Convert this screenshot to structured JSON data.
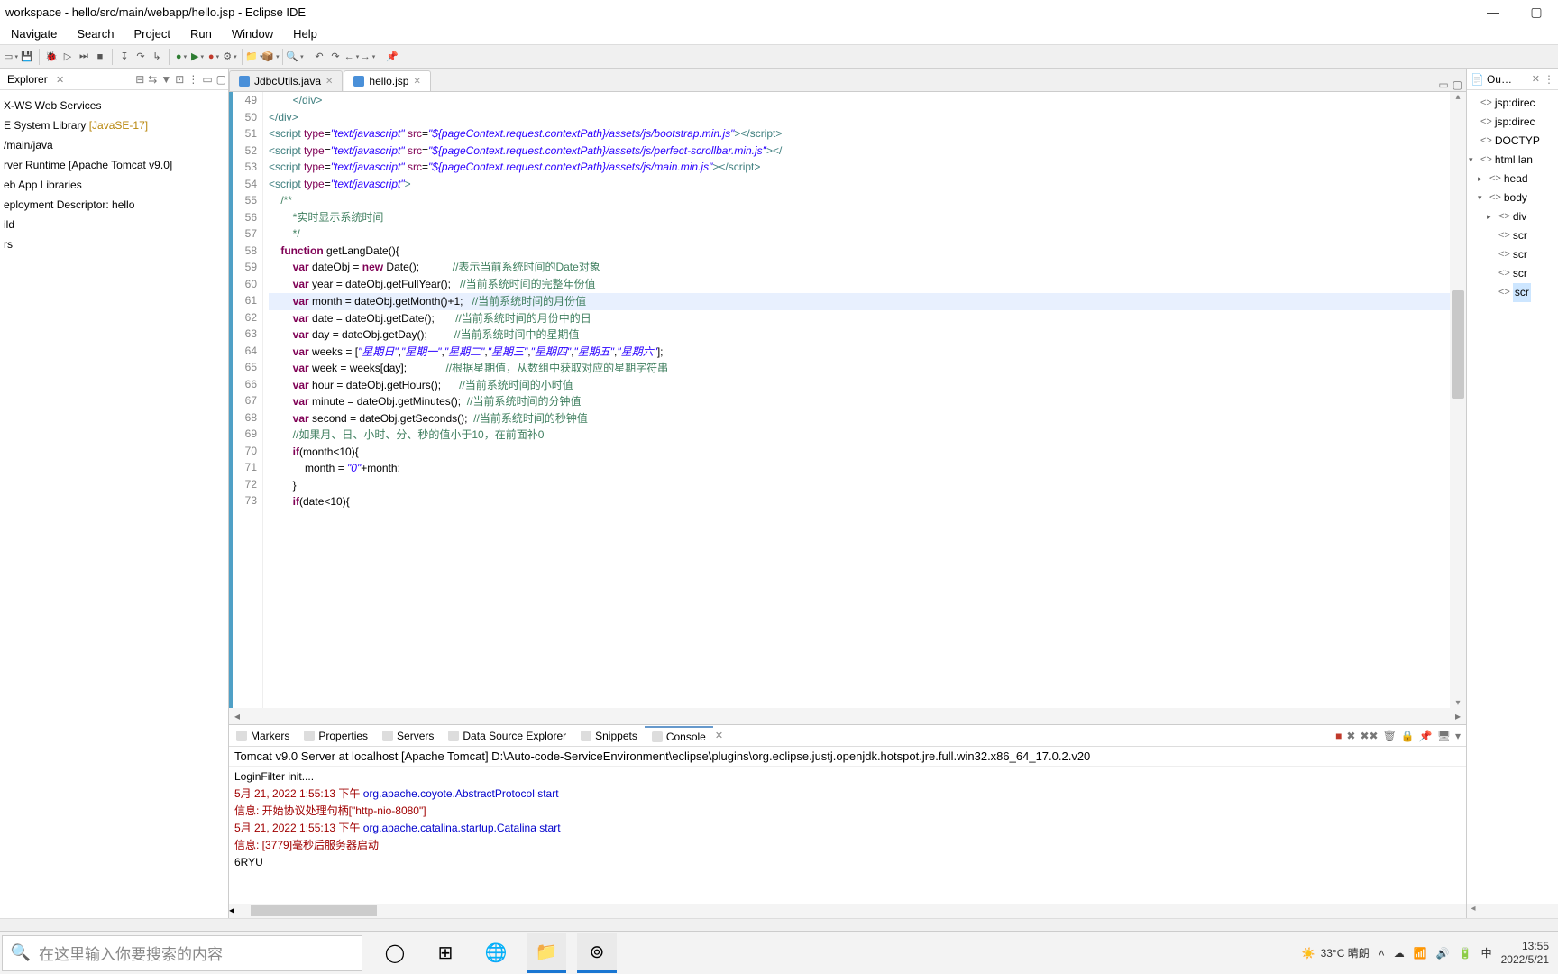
{
  "window": {
    "title": "workspace - hello/src/main/webapp/hello.jsp - Eclipse IDE"
  },
  "menu": [
    "Navigate",
    "Search",
    "Project",
    "Run",
    "Window",
    "Help"
  ],
  "explorer": {
    "title": "Explorer",
    "items": [
      {
        "label": "X-WS Web Services"
      },
      {
        "label": "E System Library ",
        "hint": "[JavaSE-17]"
      },
      {
        "label": "/main/java"
      },
      {
        "label": "rver Runtime [Apache Tomcat v9.0]"
      },
      {
        "label": "eb App Libraries"
      },
      {
        "label": "eployment Descriptor: hello"
      },
      {
        "label": "ild"
      },
      {
        "label": "rs"
      }
    ]
  },
  "editor": {
    "tabs": [
      {
        "label": "JdbcUtils.java",
        "active": false
      },
      {
        "label": "hello.jsp",
        "active": true
      }
    ],
    "firstLine": 49,
    "highlight": 61,
    "lines": [
      {
        "n": 49,
        "html": "        <span class='tag'>&lt;/div&gt;</span>"
      },
      {
        "n": 50,
        "html": "<span class='tag'>&lt;/div&gt;</span>"
      },
      {
        "n": 51,
        "html": "<span class='tag'>&lt;script</span> <span class='attr'>type</span>=<span class='str'>\"text/javascript\"</span> <span class='attr'>src</span>=<span class='str'>\"${pageContext.request.contextPath}</span><span class='str'>/assets/js/bootstrap.min.js\"</span><span class='tag'>&gt;&lt;/script&gt;</span>"
      },
      {
        "n": 52,
        "html": "<span class='tag'>&lt;script</span> <span class='attr'>type</span>=<span class='str'>\"text/javascript\"</span> <span class='attr'>src</span>=<span class='str'>\"${pageContext.request.contextPath}</span><span class='str'>/assets/js/perfect-scrollbar.min.js\"</span><span class='tag'>&gt;&lt;/</span>"
      },
      {
        "n": 53,
        "html": "<span class='tag'>&lt;script</span> <span class='attr'>type</span>=<span class='str'>\"text/javascript\"</span> <span class='attr'>src</span>=<span class='str'>\"${pageContext.request.contextPath}</span><span class='str'>/assets/js/main.min.js\"</span><span class='tag'>&gt;&lt;/script&gt;</span>"
      },
      {
        "n": 54,
        "html": "<span class='tag'>&lt;script</span> <span class='attr'>type</span>=<span class='str'>\"text/javascript\"</span><span class='tag'>&gt;</span>"
      },
      {
        "n": 55,
        "html": "    <span class='cmt'>/**</span>"
      },
      {
        "n": 56,
        "html": "        <span class='cmt'>*实时显示系统时间</span>"
      },
      {
        "n": 57,
        "html": "        <span class='cmt'>*/</span>"
      },
      {
        "n": 58,
        "html": "    <span class='kw'>function</span> getLangDate(){"
      },
      {
        "n": 59,
        "html": "        <span class='kw'>var</span> dateObj = <span class='kw'>new</span> Date();           <span class='cmt'>//表示当前系统时间的Date对象</span>"
      },
      {
        "n": 60,
        "html": "        <span class='kw'>var</span> year = dateObj.getFullYear();   <span class='cmt'>//当前系统时间的完整年份值</span>"
      },
      {
        "n": 61,
        "html": "        <span class='kw'>var</span> month = dateObj.getMonth()+1;   <span class='cmt'>//当前系统时间的月份值</span>"
      },
      {
        "n": 62,
        "html": "        <span class='kw'>var</span> date = dateObj.getDate();       <span class='cmt'>//当前系统时间的月份中的日</span>"
      },
      {
        "n": 63,
        "html": "        <span class='kw'>var</span> day = dateObj.getDay();         <span class='cmt'>//当前系统时间中的星期值</span>"
      },
      {
        "n": 64,
        "html": "        <span class='kw'>var</span> weeks = [<span class='str'>\"星期日\"</span>,<span class='str'>\"星期一\"</span>,<span class='str'>\"星期二\"</span>,<span class='str'>\"星期三\"</span>,<span class='str'>\"星期四\"</span>,<span class='str'>\"星期五\"</span>,<span class='str'>\"星期六\"</span>];"
      },
      {
        "n": 65,
        "html": "        <span class='kw'>var</span> week = weeks[day];             <span class='cmt'>//根据星期值，从数组中获取对应的星期字符串</span>"
      },
      {
        "n": 66,
        "html": "        <span class='kw'>var</span> hour = dateObj.getHours();      <span class='cmt'>//当前系统时间的小时值</span>"
      },
      {
        "n": 67,
        "html": "        <span class='kw'>var</span> minute = dateObj.getMinutes();  <span class='cmt'>//当前系统时间的分钟值</span>"
      },
      {
        "n": 68,
        "html": "        <span class='kw'>var</span> second = dateObj.getSeconds();  <span class='cmt'>//当前系统时间的秒钟值</span>"
      },
      {
        "n": 69,
        "html": "        <span class='cmt'>//如果月、日、小时、分、秒的值小于10，在前面补0</span>"
      },
      {
        "n": 70,
        "html": "        <span class='kw'>if</span>(month&lt;10){"
      },
      {
        "n": 71,
        "html": "            month = <span class='str'>\"0\"</span>+month;"
      },
      {
        "n": 72,
        "html": "        }"
      },
      {
        "n": 73,
        "html": "        <span class='kw'>if</span>(date&lt;10){"
      }
    ]
  },
  "outline": {
    "title": "Ou…",
    "items": [
      {
        "indent": 0,
        "exp": "",
        "label": "jsp:direc"
      },
      {
        "indent": 0,
        "exp": "",
        "label": "jsp:direc"
      },
      {
        "indent": 0,
        "exp": "",
        "label": "DOCTYP"
      },
      {
        "indent": 0,
        "exp": "▾",
        "label": "html lan"
      },
      {
        "indent": 1,
        "exp": "▸",
        "label": "head"
      },
      {
        "indent": 1,
        "exp": "▾",
        "label": "body"
      },
      {
        "indent": 2,
        "exp": "▸",
        "label": "div"
      },
      {
        "indent": 2,
        "exp": "",
        "label": "scr"
      },
      {
        "indent": 2,
        "exp": "",
        "label": "scr"
      },
      {
        "indent": 2,
        "exp": "",
        "label": "scr"
      },
      {
        "indent": 2,
        "exp": "",
        "label": "scr",
        "sel": true
      }
    ]
  },
  "bottomTabs": [
    "Markers",
    "Properties",
    "Servers",
    "Data Source Explorer",
    "Snippets",
    "Console"
  ],
  "bottomActive": "Console",
  "consoleDesc": "Tomcat v9.0 Server at localhost [Apache Tomcat] D:\\Auto-code-ServiceEnvironment\\eclipse\\plugins\\org.eclipse.justj.openjdk.hotspot.jre.full.win32.x86_64_17.0.2.v20",
  "console": [
    {
      "class": "",
      "text": "LoginFilter init...."
    },
    {
      "class": "con-red",
      "text": "5月 21, 2022 1:55:13 下午 <span class='con-blue'>org.apache.coyote.AbstractProtocol start</span>"
    },
    {
      "class": "con-red",
      "text": "信息: 开始协议处理句柄[\"http-nio-8080\"]"
    },
    {
      "class": "con-red",
      "text": "5月 21, 2022 1:55:13 下午 <span class='con-blue'>org.apache.catalina.startup.Catalina start</span>"
    },
    {
      "class": "con-red",
      "text": "信息: [3779]毫秒后服务器启动"
    },
    {
      "class": "",
      "text": "6RYU"
    }
  ],
  "taskbar": {
    "searchPlaceholder": "在这里输入你要搜索的内容",
    "weather": "33°C 晴朗",
    "time": "13:55",
    "date": "2022/5/21",
    "ime": "中"
  }
}
